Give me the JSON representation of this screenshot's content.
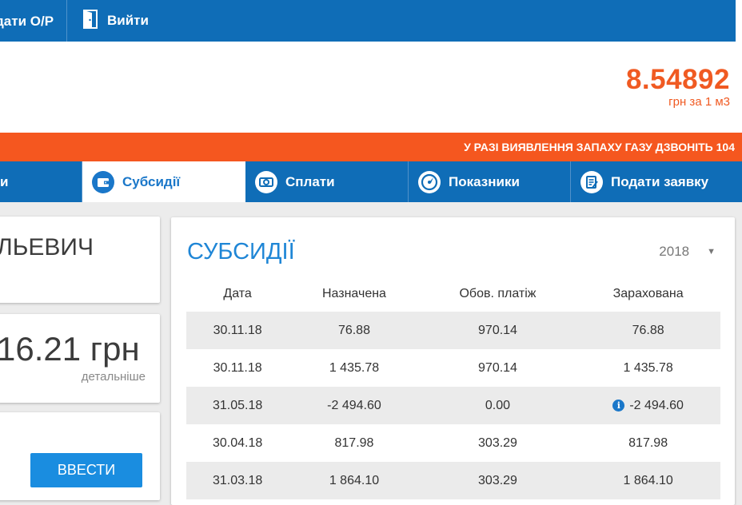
{
  "topbar": {
    "submit_op_label": "дати О/Р",
    "exit_label": "Вийти"
  },
  "price": {
    "value": "8.54892",
    "unit": "грн за 1 м3"
  },
  "alert": {
    "text": "У РАЗІ ВИЯВЛЕННЯ ЗАПАХУ ГАЗУ ДЗВОНІТЬ 104"
  },
  "tabs": [
    {
      "label": "и",
      "icon": "none"
    },
    {
      "label": "Субсидії",
      "icon": "wallet-icon"
    },
    {
      "label": "Сплати",
      "icon": "money-icon"
    },
    {
      "label": "Показники",
      "icon": "gauge-icon"
    },
    {
      "label": "Подати заявку",
      "icon": "form-icon"
    }
  ],
  "profile": {
    "name_fragment": "ЛЬЕВИЧ"
  },
  "balance": {
    "amount": "16.21 грн",
    "details_label": "детальніше"
  },
  "readings": {
    "enter_label": "ВВЕСТИ"
  },
  "subsidies": {
    "title": "СУБСИДІЇ",
    "year": "2018",
    "columns": [
      "Дата",
      "Назначена",
      "Обов. платіж",
      "Зарахована"
    ],
    "rows": [
      {
        "date": "30.11.18",
        "assigned": "76.88",
        "payment": "970.14",
        "credited": "76.88"
      },
      {
        "date": "30.11.18",
        "assigned": "1 435.78",
        "payment": "970.14",
        "credited": "1 435.78"
      },
      {
        "date": "31.05.18",
        "assigned": "-2 494.60",
        "payment": "0.00",
        "credited": "-2 494.60"
      },
      {
        "date": "30.04.18",
        "assigned": "817.98",
        "payment": "303.29",
        "credited": "817.98"
      },
      {
        "date": "31.03.18",
        "assigned": "1 864.10",
        "payment": "303.29",
        "credited": "1 864.10"
      }
    ]
  },
  "colors": {
    "primary_blue": "#0f6db7",
    "accent_orange": "#f05a22",
    "alert_orange": "#f5571f",
    "title_blue": "#1f86d6",
    "button_blue": "#1a8de0"
  }
}
